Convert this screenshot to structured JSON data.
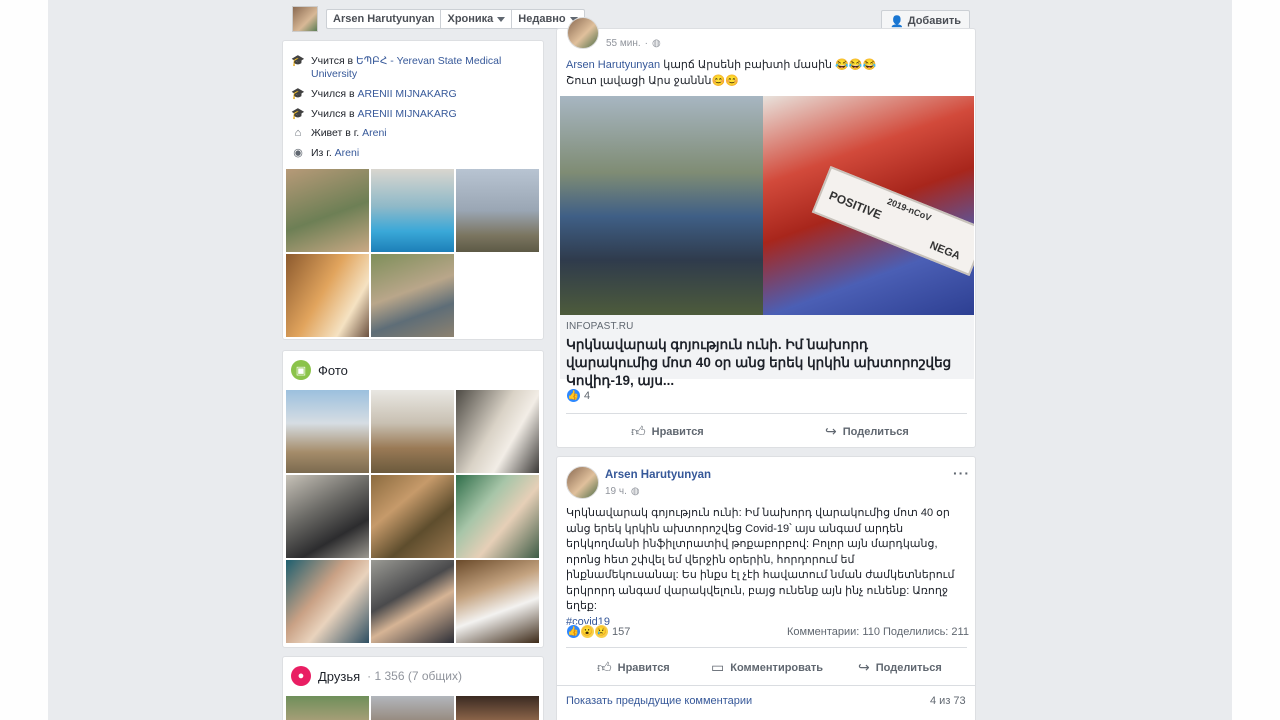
{
  "topbar": {
    "profile_name": "Arsen Harutyunyan",
    "tab_timeline": "Хроника",
    "tab_recent": "Недавно",
    "add_button": "Добавить"
  },
  "intro": {
    "rows": [
      {
        "prefix": "Учится в ",
        "link": "ԵՊԲՀ - Yerevan State Medical University",
        "icon": "graduation-cap-icon"
      },
      {
        "prefix": "Учился в ",
        "link": "ARENII MIJNAKARG",
        "icon": "graduation-cap-icon"
      },
      {
        "prefix": "Учился в ",
        "link": "ARENII MIJNAKARG",
        "icon": "graduation-cap-icon"
      },
      {
        "prefix": "Живет в г. ",
        "link": "Areni",
        "icon": "home-icon"
      },
      {
        "prefix": "Из г. ",
        "link": "Areni",
        "icon": "location-pin-icon"
      }
    ]
  },
  "photos": {
    "title": "Фото"
  },
  "friends": {
    "title": "Друзья",
    "count": " · 1 356 (7 общих)"
  },
  "post1": {
    "time": "55 мин.",
    "author_link": "Arsen Harutyunyan",
    "text_line1": " կարճ Արսենի բախտի մասին 😂😂😂",
    "text_line2": "Շուտ լավացի Արս ջաննն😊😊",
    "link_domain": "INFOPAST.RU",
    "link_title": "Կրկնավարակ գոյություն ունի. Իմ նախորդ վարակումից մոտ 40 օր անց երեկ կրկին ախտորոշվեց Կովիդ-19, այս...",
    "image_text_1": "2019-nCoV",
    "image_text_2": "POSITIVE",
    "image_text_3": "NEGA",
    "like_count": "4",
    "like_button": "Нравится",
    "share_button": "Поделиться"
  },
  "post2": {
    "author": "Arsen Harutyunyan",
    "time": "19 ч.",
    "text": "Կրկնավարակ գոյություն ունի: Իմ նախորդ վարակումից մոտ 40 օր անց երեկ կրկին ախտորոշվեց Covid-19՝ այս անգամ արդեն երկկողմանի ինֆիլտրատիվ թոքաբորբով: Բոլոր այն մարդկանց, որոնց հետ շփվել եմ վերջին օրերին, հորդորում եմ ինքնամեկուսանալ: Ես ինքս էլ չէի հավատում նման ժամկետներում երկրորդ անգամ վարակվելուն, բայց ունենք այն ինչ ունենք: Առողջ եղեք:",
    "hashtag": "#covid19",
    "reaction_count": "157",
    "comments_count": "Комментарии: 110",
    "shares_count": "Поделились: 211",
    "like_button": "Нравится",
    "comment_button": "Комментировать",
    "share_button": "Поделиться",
    "show_previous": "Показать предыдущие комментарии",
    "comments_range": "4 из 73"
  },
  "colors": {
    "link": "#365899",
    "background": "#e9ebee",
    "photos_icon": "#8bc34a",
    "friends_icon": "#e91e63"
  }
}
